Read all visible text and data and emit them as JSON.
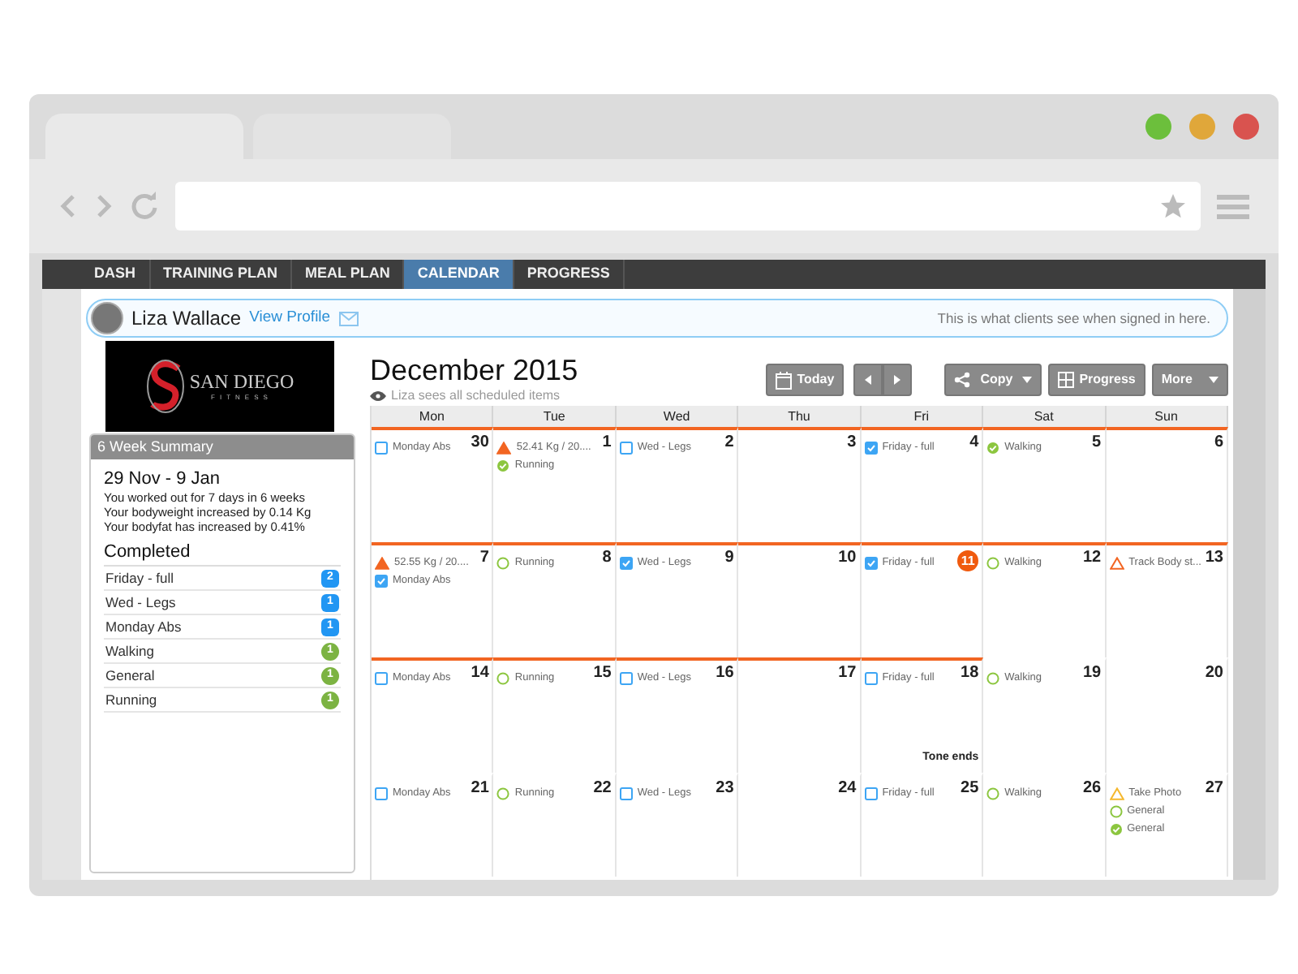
{
  "nav_tabs": [
    {
      "label": "DASH",
      "selected": false
    },
    {
      "label": "TRAINING PLAN",
      "selected": false
    },
    {
      "label": "MEAL PLAN",
      "selected": false
    },
    {
      "label": "CALENDAR",
      "selected": true
    },
    {
      "label": "PROGRESS",
      "selected": false
    }
  ],
  "profile": {
    "name": "Liza Wallace",
    "link": "View Profile",
    "note": "This is what clients see when signed in here."
  },
  "logo": {
    "name": "SAN DIEGO",
    "tagline": "FITNESS"
  },
  "summary": {
    "title": "6 Week Summary",
    "range": "29 Nov - 9 Jan",
    "lines": [
      "You worked out for 7 days in 6 weeks",
      "Your bodyweight increased by 0.14 Kg",
      "Your bodyfat has increased by 0.41%"
    ],
    "completed_title": "Completed",
    "items": [
      {
        "name": "Friday - full",
        "count": "2",
        "color": "#2196f3"
      },
      {
        "name": "Wed - Legs",
        "count": "1",
        "color": "#2196f3"
      },
      {
        "name": "Monday Abs",
        "count": "1",
        "color": "#2196f3"
      },
      {
        "name": "Walking",
        "count": "1",
        "color": "#7cb342"
      },
      {
        "name": "General",
        "count": "1",
        "color": "#7cb342"
      },
      {
        "name": "Running",
        "count": "1",
        "color": "#7cb342"
      }
    ]
  },
  "calendar": {
    "title": "December 2015",
    "visibility_note": "Liza sees all scheduled items",
    "toolbar": [
      {
        "kind": "today",
        "label": "Today"
      },
      {
        "kind": "pager"
      },
      {
        "kind": "copy",
        "label": "Copy"
      },
      {
        "kind": "progress",
        "label": "Progress"
      },
      {
        "kind": "more",
        "label": "More"
      }
    ],
    "weekdays": [
      "Mon",
      "Tue",
      "Wed",
      "Thu",
      "Fri",
      "Sat",
      "Sun"
    ],
    "weeks": [
      {
        "days": [
          {
            "number": "30",
            "marked": true,
            "today": false,
            "events": [
              {
                "kind": "workout",
                "done": false,
                "label": "Monday Abs"
              }
            ]
          },
          {
            "number": "1",
            "marked": true,
            "today": false,
            "events": [
              {
                "kind": "metric",
                "done": true,
                "label": "52.41 Kg / 20...."
              },
              {
                "kind": "cardio",
                "done": true,
                "label": "Running"
              }
            ]
          },
          {
            "number": "2",
            "marked": true,
            "today": false,
            "events": [
              {
                "kind": "workout",
                "done": false,
                "label": "Wed - Legs"
              }
            ]
          },
          {
            "number": "3",
            "marked": true,
            "today": false
          },
          {
            "number": "4",
            "marked": true,
            "today": false,
            "events": [
              {
                "kind": "workout",
                "done": true,
                "label": "Friday - full"
              }
            ]
          },
          {
            "number": "5",
            "marked": true,
            "today": false,
            "events": [
              {
                "kind": "cardio",
                "done": true,
                "label": "Walking"
              }
            ]
          },
          {
            "number": "6",
            "marked": true,
            "today": false
          }
        ]
      },
      {
        "days": [
          {
            "number": "7",
            "marked": true,
            "today": false,
            "events": [
              {
                "kind": "metric",
                "done": true,
                "label": "52.55 Kg / 20...."
              },
              {
                "kind": "workout",
                "done": true,
                "label": "Monday Abs"
              }
            ]
          },
          {
            "number": "8",
            "marked": true,
            "today": false,
            "events": [
              {
                "kind": "cardio",
                "done": false,
                "label": "Running"
              }
            ]
          },
          {
            "number": "9",
            "marked": true,
            "today": false,
            "events": [
              {
                "kind": "workout",
                "done": true,
                "label": "Wed - Legs"
              }
            ]
          },
          {
            "number": "10",
            "marked": true,
            "today": false
          },
          {
            "number": "11",
            "marked": true,
            "today": true,
            "events": [
              {
                "kind": "workout",
                "done": true,
                "label": "Friday - full"
              }
            ]
          },
          {
            "number": "12",
            "marked": true,
            "today": false,
            "events": [
              {
                "kind": "cardio",
                "done": false,
                "label": "Walking"
              }
            ]
          },
          {
            "number": "13",
            "marked": true,
            "today": false,
            "events": [
              {
                "kind": "metric",
                "done": false,
                "label": "Track Body st..."
              }
            ]
          }
        ]
      },
      {
        "days": [
          {
            "number": "14",
            "marked": true,
            "today": false,
            "events": [
              {
                "kind": "workout",
                "done": false,
                "label": "Monday Abs"
              }
            ]
          },
          {
            "number": "15",
            "marked": true,
            "today": false,
            "events": [
              {
                "kind": "cardio",
                "done": false,
                "label": "Running"
              }
            ]
          },
          {
            "number": "16",
            "marked": true,
            "today": false,
            "events": [
              {
                "kind": "workout",
                "done": false,
                "label": "Wed - Legs"
              }
            ]
          },
          {
            "number": "17",
            "marked": true,
            "today": false
          },
          {
            "number": "18",
            "marked": true,
            "today": false,
            "events": [
              {
                "kind": "workout",
                "done": false,
                "label": "Friday - full"
              }
            ],
            "note": "Tone ends"
          },
          {
            "number": "19",
            "marked": false,
            "today": false,
            "events": [
              {
                "kind": "cardio",
                "done": false,
                "label": "Walking"
              }
            ]
          },
          {
            "number": "20",
            "marked": false,
            "today": false
          }
        ]
      },
      {
        "days": [
          {
            "number": "21",
            "marked": false,
            "today": false,
            "events": [
              {
                "kind": "workout",
                "done": false,
                "label": "Monday Abs"
              }
            ]
          },
          {
            "number": "22",
            "marked": false,
            "today": false,
            "events": [
              {
                "kind": "cardio",
                "done": false,
                "label": "Running"
              }
            ]
          },
          {
            "number": "23",
            "marked": false,
            "today": false,
            "events": [
              {
                "kind": "workout",
                "done": false,
                "label": "Wed - Legs"
              }
            ]
          },
          {
            "number": "24",
            "marked": false,
            "today": false
          },
          {
            "number": "25",
            "marked": false,
            "today": false,
            "events": [
              {
                "kind": "workout",
                "done": false,
                "label": "Friday - full"
              }
            ]
          },
          {
            "number": "26",
            "marked": false,
            "today": false,
            "events": [
              {
                "kind": "cardio",
                "done": false,
                "label": "Walking"
              }
            ]
          },
          {
            "number": "27",
            "marked": false,
            "today": false,
            "events": [
              {
                "kind": "photo",
                "done": false,
                "label": "Take Photo"
              },
              {
                "kind": "cardio",
                "done": false,
                "label": "General"
              },
              {
                "kind": "cardio",
                "done": true,
                "label": "General"
              }
            ]
          }
        ]
      }
    ]
  }
}
